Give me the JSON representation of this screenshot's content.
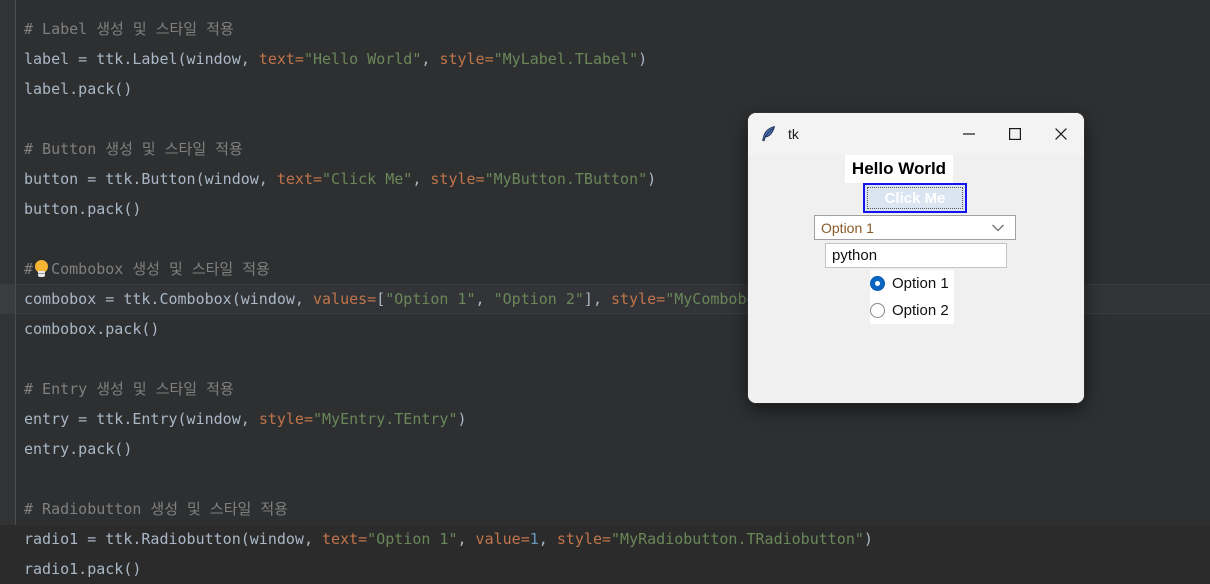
{
  "editor": {
    "colors": {
      "background": "#2d2f31",
      "gutter": "#313335",
      "text": "#a9b7c6",
      "comment": "#808080",
      "keyword_arg": "#c0744a",
      "string": "#6a8759",
      "number": "#6897bb",
      "current_line": "#323437"
    },
    "intention_icon": "lightbulb-icon",
    "lines": [
      {
        "id": "l1",
        "segments": [
          {
            "cls": "cmt",
            "t": "# Label 생성 및 스타일 적용"
          }
        ]
      },
      {
        "id": "l2",
        "segments": [
          {
            "cls": "plain",
            "t": "label = ttk.Label(window, "
          },
          {
            "cls": "kwarg",
            "t": "text="
          },
          {
            "cls": "str",
            "t": "\"Hello World\""
          },
          {
            "cls": "plain",
            "t": ", "
          },
          {
            "cls": "kwarg",
            "t": "style="
          },
          {
            "cls": "str",
            "t": "\"MyLabel.TLabel\""
          },
          {
            "cls": "plain",
            "t": ")"
          }
        ]
      },
      {
        "id": "l3",
        "segments": [
          {
            "cls": "plain",
            "t": "label.pack()"
          }
        ]
      },
      {
        "id": "l4",
        "segments": [
          {
            "cls": "plain",
            "t": ""
          }
        ]
      },
      {
        "id": "l5",
        "segments": [
          {
            "cls": "cmt",
            "t": "# Button 생성 및 스타일 적용"
          }
        ]
      },
      {
        "id": "l6",
        "segments": [
          {
            "cls": "plain",
            "t": "button = ttk.Button(window, "
          },
          {
            "cls": "kwarg",
            "t": "text="
          },
          {
            "cls": "str",
            "t": "\"Click Me\""
          },
          {
            "cls": "plain",
            "t": ", "
          },
          {
            "cls": "kwarg",
            "t": "style="
          },
          {
            "cls": "str",
            "t": "\"MyButton.TButton\""
          },
          {
            "cls": "plain",
            "t": ")"
          }
        ]
      },
      {
        "id": "l7",
        "segments": [
          {
            "cls": "plain",
            "t": "button.pack()"
          }
        ]
      },
      {
        "id": "l8",
        "segments": [
          {
            "cls": "plain",
            "t": ""
          }
        ]
      },
      {
        "id": "l9",
        "segments": [
          {
            "cls": "cmt",
            "t": "#  Combobox 생성 및 스타일 적용"
          }
        ]
      },
      {
        "id": "l10",
        "segments": [
          {
            "cls": "plain",
            "t": "combobox = ttk.Combobox(window, "
          },
          {
            "cls": "kwarg",
            "t": "values="
          },
          {
            "cls": "plain",
            "t": "["
          },
          {
            "cls": "str",
            "t": "\"Option 1\""
          },
          {
            "cls": "plain",
            "t": ", "
          },
          {
            "cls": "str",
            "t": "\"Option 2\""
          },
          {
            "cls": "plain",
            "t": "], "
          },
          {
            "cls": "kwarg",
            "t": "style="
          },
          {
            "cls": "str",
            "t": "\"MyCombobox.TCombobox\""
          },
          {
            "cls": "plain",
            "t": ")"
          }
        ]
      },
      {
        "id": "l11",
        "segments": [
          {
            "cls": "plain",
            "t": "combobox.pack()"
          }
        ]
      },
      {
        "id": "l12",
        "segments": [
          {
            "cls": "plain",
            "t": ""
          }
        ]
      },
      {
        "id": "l13",
        "segments": [
          {
            "cls": "cmt",
            "t": "# Entry 생성 및 스타일 적용"
          }
        ]
      },
      {
        "id": "l14",
        "segments": [
          {
            "cls": "plain",
            "t": "entry = ttk.Entry(window, "
          },
          {
            "cls": "kwarg",
            "t": "style="
          },
          {
            "cls": "str",
            "t": "\"MyEntry.TEntry\""
          },
          {
            "cls": "plain",
            "t": ")"
          }
        ]
      },
      {
        "id": "l15",
        "segments": [
          {
            "cls": "plain",
            "t": "entry.pack()"
          }
        ]
      },
      {
        "id": "l16",
        "segments": [
          {
            "cls": "plain",
            "t": ""
          }
        ]
      },
      {
        "id": "l17",
        "segments": [
          {
            "cls": "cmt",
            "t": "# Radiobutton 생성 및 스타일 적용"
          }
        ]
      },
      {
        "id": "l18",
        "segments": [
          {
            "cls": "plain",
            "t": "radio1 = ttk.Radiobutton(window, "
          },
          {
            "cls": "kwarg",
            "t": "text="
          },
          {
            "cls": "str",
            "t": "\"Option 1\""
          },
          {
            "cls": "plain",
            "t": ", "
          },
          {
            "cls": "kwarg",
            "t": "value="
          },
          {
            "cls": "num",
            "t": "1"
          },
          {
            "cls": "plain",
            "t": ", "
          },
          {
            "cls": "kwarg",
            "t": "style="
          },
          {
            "cls": "str",
            "t": "\"MyRadiobutton.TRadiobutton\""
          },
          {
            "cls": "plain",
            "t": ")"
          }
        ]
      },
      {
        "id": "l19",
        "segments": [
          {
            "cls": "plain",
            "t": "radio1.pack()"
          }
        ]
      }
    ],
    "current_line_index": 9
  },
  "tk_window": {
    "title": "tk",
    "icon": "feather-icon",
    "controls": {
      "minimize": "minimize-icon",
      "maximize": "maximize-icon",
      "close": "close-icon"
    },
    "widgets": {
      "label": "Hello World",
      "button": "Click Me",
      "combobox_value": "Option 1",
      "combobox_options": [
        "Option 1",
        "Option 2"
      ],
      "entry_value": "python",
      "radios": [
        {
          "label": "Option 1",
          "selected": true
        },
        {
          "label": "Option 2",
          "selected": false
        }
      ]
    },
    "colors": {
      "chrome": "#f3f3f3",
      "client": "#f0f0f0",
      "button_border": "#1414ef",
      "button_fill": "#dbe5f1",
      "radio_accent": "#0a66c2",
      "combobox_text": "#8a5a28"
    }
  }
}
